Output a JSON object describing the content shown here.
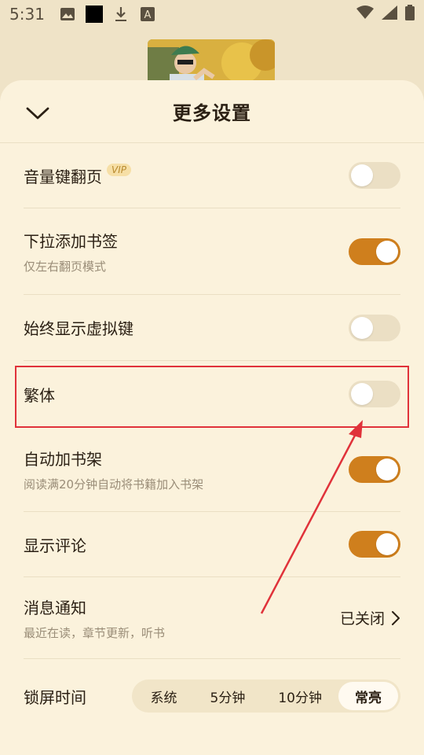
{
  "status_bar": {
    "time": "5:31",
    "left_icons": [
      "image-icon",
      "black-square-icon",
      "download-icon",
      "text-a-icon"
    ],
    "right_icons": [
      "wifi-icon",
      "signal-icon",
      "battery-icon"
    ]
  },
  "sheet": {
    "title": "更多设置",
    "collapse_icon": "chevron-down-icon"
  },
  "settings": [
    {
      "label": "音量键翻页",
      "badge": "VIP",
      "toggle": false
    },
    {
      "label": "下拉添加书签",
      "sub": "仅左右翻页模式",
      "toggle": true
    },
    {
      "label": "始终显示虚拟键",
      "toggle": false
    },
    {
      "label": "繁体",
      "toggle": false
    },
    {
      "label": "自动加书架",
      "sub": "阅读满20分钟自动将书籍加入书架",
      "toggle": true
    },
    {
      "label": "显示评论",
      "toggle": true
    }
  ],
  "notification": {
    "label": "消息通知",
    "sub": "最近在读，章节更新，听书",
    "value": "已关闭"
  },
  "lock_screen": {
    "label": "锁屏时间",
    "options": [
      "系统",
      "5分钟",
      "10分钟",
      "常亮"
    ],
    "selected": "常亮"
  },
  "colors": {
    "accent": "#cf7f1d",
    "sheet_bg": "#fbf2dc",
    "annotation": "#e0323a"
  }
}
